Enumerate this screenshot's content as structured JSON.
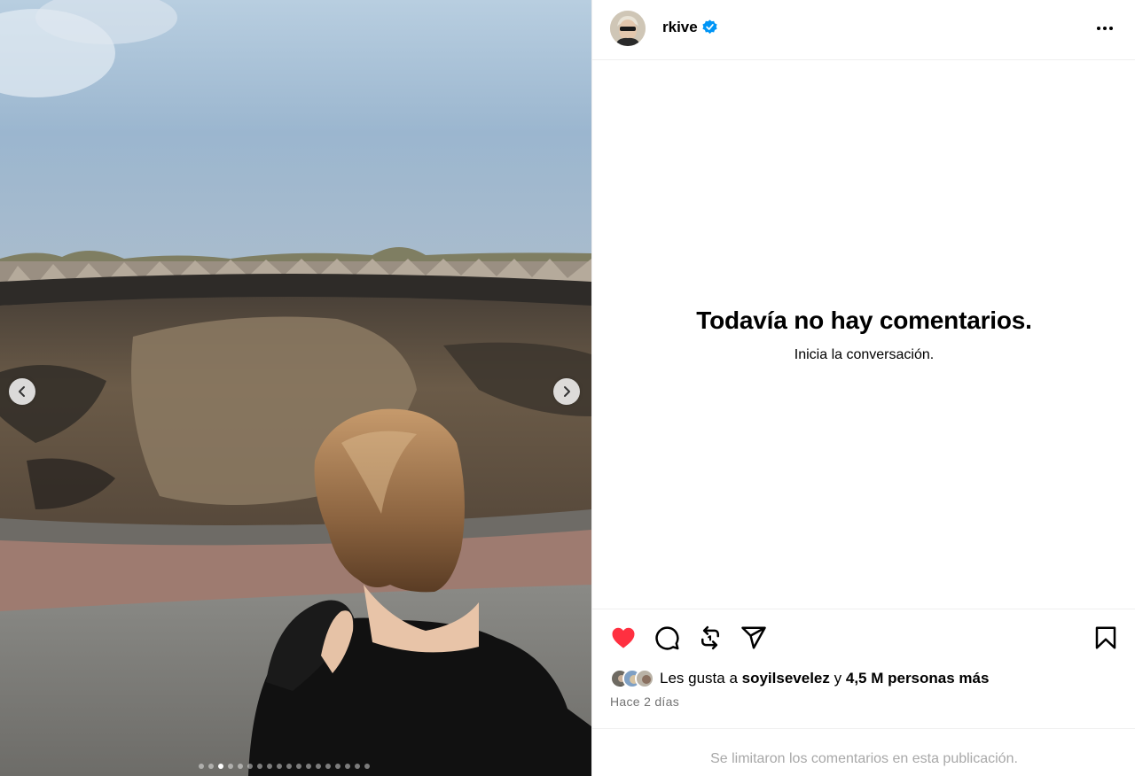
{
  "post": {
    "username": "rkive",
    "verified": true,
    "more_icon": "more-horizontal-icon"
  },
  "comments": {
    "empty_title": "Todavía no hay comentarios.",
    "empty_subtitle": "Inicia la conversación."
  },
  "actions": {
    "like_icon": "heart-filled-icon",
    "comment_icon": "comment-icon",
    "repost_icon": "repost-icon",
    "share_icon": "send-icon",
    "save_icon": "bookmark-icon",
    "liked": true,
    "like_color": "#ff3040"
  },
  "likes": {
    "prefix": "Les gusta a",
    "user": "soyilsevelez",
    "connector": "y",
    "others": "4,5 M personas más"
  },
  "timestamp": "Hace 2 días",
  "footer": {
    "limited_comments": "Se limitaron los comentarios en esta publicación."
  },
  "carousel": {
    "total": 18,
    "current": 3
  }
}
